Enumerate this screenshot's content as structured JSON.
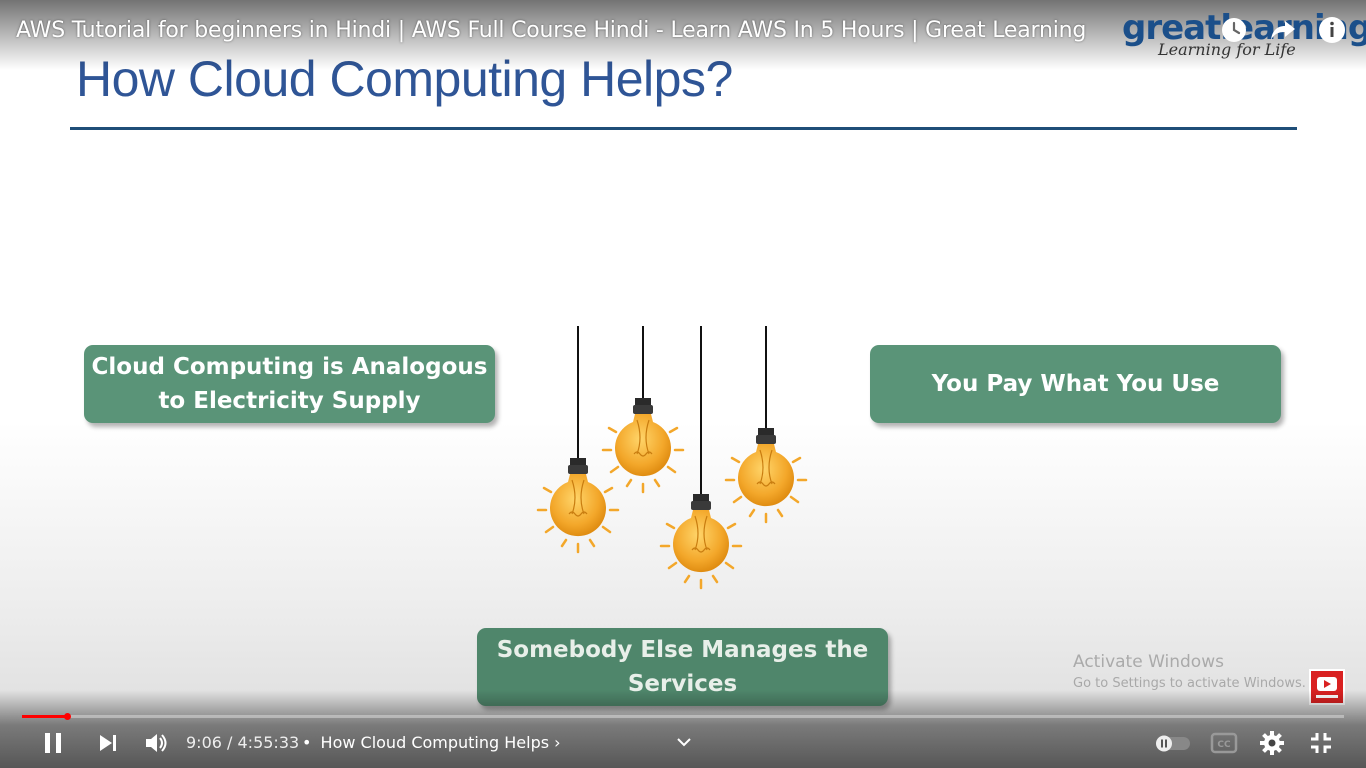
{
  "video": {
    "title": "AWS Tutorial for beginners in Hindi | AWS Full Course Hindi - Learn AWS In 5 Hours | Great Learning"
  },
  "brand": {
    "wordmark": "greatlearning",
    "tagline": "Learning for Life"
  },
  "slide": {
    "title": "How Cloud Computing Helps?",
    "cards": [
      {
        "line1": "Cloud Computing is Analogous",
        "line2": "to Electricity Supply"
      },
      {
        "line1": "You Pay What You Use",
        "line2": ""
      },
      {
        "line1": "Somebody Else Manages the",
        "line2": "Services"
      }
    ]
  },
  "watermark": {
    "title": "Activate Windows",
    "subtitle": "Go to Settings to activate Windows."
  },
  "player": {
    "current_time": "9:06",
    "duration": "4:55:33",
    "time_display": "9:06 / 4:55:33",
    "chapter_sep": "•",
    "chapter": "How Cloud Computing Helps",
    "chapter_chevron": "›",
    "progress_fraction": 0.0337,
    "icons": {
      "play_pause": "pause-icon",
      "next": "next-icon",
      "volume": "volume-icon",
      "chapters_toggle": "chevron-down-icon",
      "autoplay": "autoplay-toggle-icon",
      "captions": "cc-icon",
      "settings": "gear-icon",
      "fullscreen_exit": "exit-fullscreen-icon",
      "watch_later": "clock-icon",
      "share": "share-icon",
      "info": "info-icon"
    }
  },
  "colors": {
    "title_blue": "#2f5596",
    "card_green": "#5a9478",
    "progress_red": "#ff0000",
    "bulb_amber": "#f3a72a"
  }
}
